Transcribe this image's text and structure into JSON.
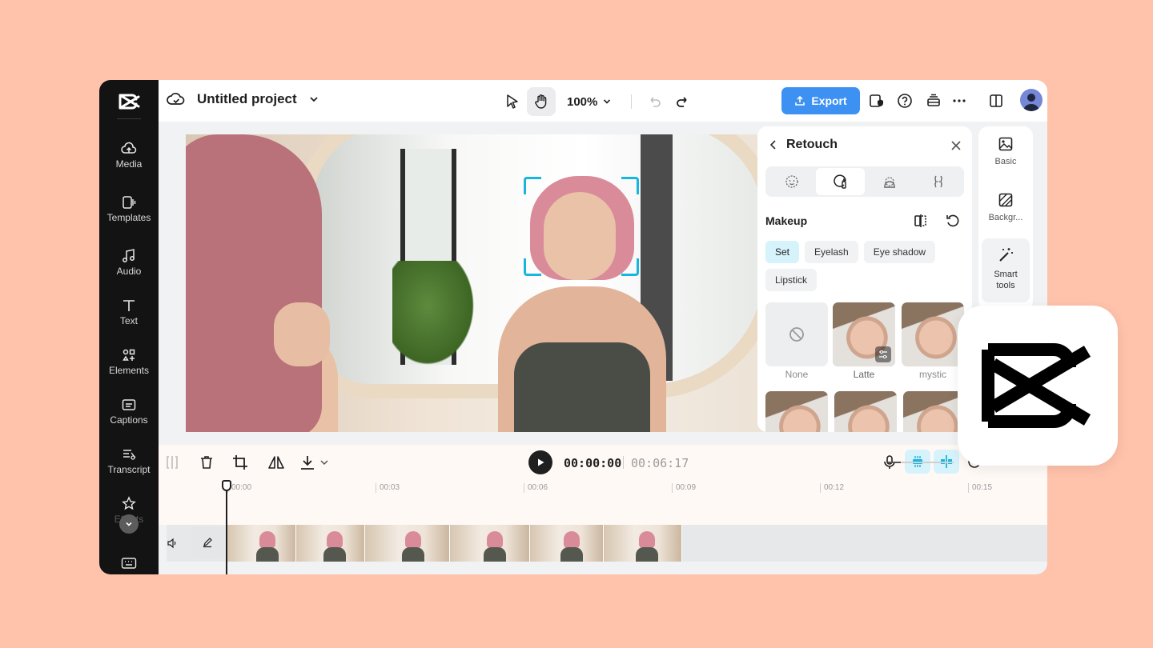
{
  "app": {
    "name": "CapCut"
  },
  "sidebar": {
    "items": [
      {
        "label": "Media",
        "icon": "cloud-upload-icon"
      },
      {
        "label": "Templates",
        "icon": "templates-icon"
      },
      {
        "label": "Audio",
        "icon": "music-note-icon"
      },
      {
        "label": "Text",
        "icon": "text-icon"
      },
      {
        "label": "Elements",
        "icon": "elements-icon"
      },
      {
        "label": "Captions",
        "icon": "captions-icon"
      },
      {
        "label": "Transcript",
        "icon": "transcript-icon"
      },
      {
        "label": "Effects",
        "icon": "effects-icon"
      }
    ]
  },
  "header": {
    "project_title": "Untitled project",
    "zoom": "100%",
    "export_label": "Export"
  },
  "retouch": {
    "title": "Retouch",
    "section": "Makeup",
    "tabs": [
      "face-icon",
      "makeup-icon",
      "body-icon",
      "figure-icon"
    ],
    "chips": [
      {
        "label": "Set",
        "active": true
      },
      {
        "label": "Eyelash",
        "active": false
      },
      {
        "label": "Eye shadow",
        "active": false
      },
      {
        "label": "Lipstick",
        "active": false
      }
    ],
    "presets": [
      {
        "label": "None",
        "selected": false
      },
      {
        "label": "Latte",
        "selected": true
      },
      {
        "label": "mystic",
        "selected": false
      }
    ]
  },
  "right_panel": {
    "items": [
      {
        "label": "Basic",
        "icon": "image-icon"
      },
      {
        "label": "Backgr...",
        "icon": "background-icon"
      },
      {
        "label": "Smart tools",
        "icon": "magic-wand-icon"
      }
    ]
  },
  "timeline": {
    "current_time": "00:00:00",
    "duration": "00:06:17",
    "ticks": [
      "00:00",
      "00:03",
      "00:06",
      "00:09",
      "00:12",
      "00:15"
    ],
    "zoom_fraction": 0.2
  },
  "colors": {
    "page_background": "#ffc2ab",
    "accent": "#3d91f2",
    "selection": "#18b6de",
    "sidebar": "#131313"
  }
}
